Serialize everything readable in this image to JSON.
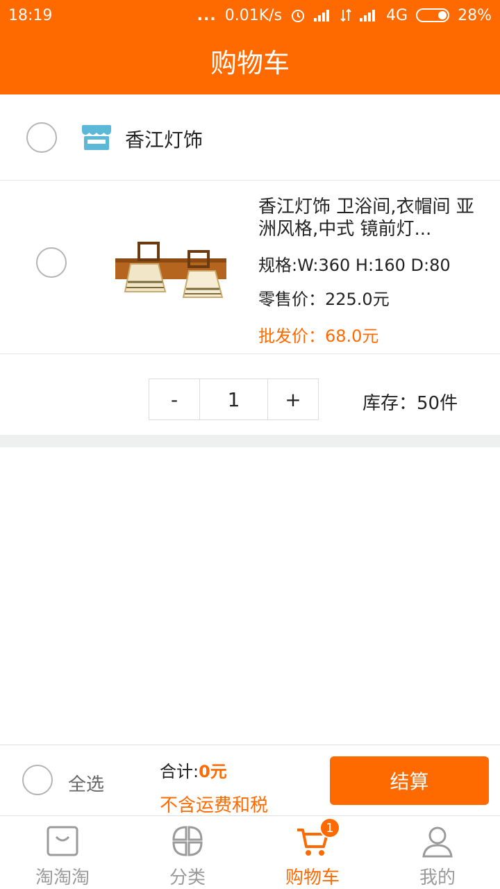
{
  "status_bar": {
    "time": "18:19",
    "dots": "...",
    "speed": "0.01K/s",
    "network": "4G",
    "battery": "28%"
  },
  "header": {
    "title": "购物车"
  },
  "shop": {
    "name": "香江灯饰"
  },
  "product": {
    "title": "香江灯饰 卫浴间,衣帽间 亚洲风格,中式 镜前灯...",
    "spec": "规格:W:360 H:160 D:80",
    "retail_price": "零售价：225.0元",
    "wholesale_price": "批发价：68.0元"
  },
  "quantity": {
    "minus_label": "-",
    "value": "1",
    "plus_label": "+",
    "stock": "库存：50件"
  },
  "checkout": {
    "select_all_label": "全选",
    "total_label": "合计:",
    "total_amount": "0元",
    "note": "不含运费和税",
    "pay_label": "结算"
  },
  "tabs": [
    {
      "label": "淘淘淘",
      "icon": "bag-icon"
    },
    {
      "label": "分类",
      "icon": "category-icon"
    },
    {
      "label": "购物车",
      "icon": "cart-icon",
      "badge": "1"
    },
    {
      "label": "我的",
      "icon": "user-icon"
    }
  ],
  "colors": {
    "accent": "#ff6a00",
    "inactive": "#9a9a9a",
    "shop_icon": "#5bb8d6"
  }
}
